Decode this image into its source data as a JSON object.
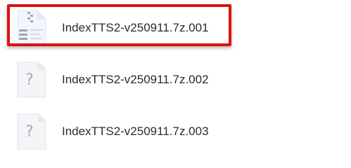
{
  "accent_color": "#e01010",
  "text_color": "#2b2b2b",
  "files": [
    {
      "name": "IndexTTS2-v250911.7z.001",
      "icon": "archive-file-icon",
      "highlighted": true
    },
    {
      "name": "IndexTTS2-v250911.7z.002",
      "icon": "unknown-file-icon",
      "highlighted": false
    },
    {
      "name": "IndexTTS2-v250911.7z.003",
      "icon": "unknown-file-icon",
      "highlighted": false
    }
  ]
}
